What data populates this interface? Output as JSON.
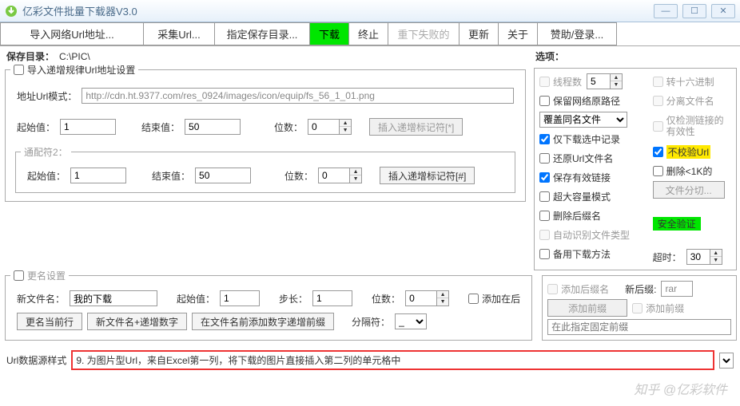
{
  "window": {
    "title": "亿彩文件批量下载器V3.0"
  },
  "toolbar": {
    "import_url": "导入网络Url地址...",
    "collect_url": "采集Url...",
    "set_dir": "指定保存目录...",
    "download": "下载",
    "stop": "终止",
    "redownload": "重下失败的",
    "update": "更新",
    "about": "关于",
    "sponsor": "赞助/登录..."
  },
  "save_dir": {
    "label": "保存目录：",
    "value": "C:\\PIC\\"
  },
  "url_pattern": {
    "legend": "导入递增规律Url地址设置",
    "pattern_label": "地址Url模式：",
    "pattern_value": "http://cdn.ht.9377.com/res_0924/images/icon/equip/fs_56_1_01.png",
    "start_label": "起始值：",
    "start_value": "1",
    "end_label": "结束值：",
    "end_value": "50",
    "digits_label": "位数：",
    "digits_value": "0",
    "insert1": "插入递增标记符[*]",
    "wildcard_label": "通配符2：",
    "insert2": "插入递增标记符[#]"
  },
  "options": {
    "title": "选项：",
    "threads_label": "线程数",
    "threads_value": "5",
    "to_hex": "转十六进制",
    "keep_path": "保留网络原路径",
    "split_name": "分离文件名",
    "overwrite": "覆盖同名文件",
    "check_only": "仅检测链接的有效性",
    "download_checked": "仅下载选中记录",
    "no_verify_url": "不校验Url",
    "restore_name": "还原Url文件名",
    "delete_lt1k": "删除<1K的",
    "keep_valid": "保存有效链接",
    "file_split": "文件分切...",
    "big_capacity": "超大容量模式",
    "delete_ext": "删除后缀名",
    "security": "安全验证",
    "auto_detect": "自动识别文件类型",
    "backup_method": "备用下载方法",
    "timeout_label": "超时：",
    "timeout_value": "30"
  },
  "rename": {
    "legend": "更名设置",
    "newname_label": "新文件名：",
    "newname_value": "我的下载",
    "start_label": "起始值：",
    "start_value": "1",
    "step_label": "步长：",
    "step_value": "1",
    "digits_label": "位数：",
    "digits_value": "0",
    "append_after": "添加在后",
    "rename_current": "更名当前行",
    "newname_inc": "新文件名+递增数字",
    "add_prefix_num": "在文件名前添加数字递增前缀",
    "sep_label": "分隔符：",
    "sep_value": "_"
  },
  "suffix": {
    "add_ext": "添加后缀名",
    "new_ext_label": "新后缀:",
    "new_ext_value": "rar",
    "add_prefix_btn": "添加前缀",
    "add_prefix_cb": "添加前缀",
    "fixed_prefix_ph": "在此指定固定前缀"
  },
  "datasource": {
    "label": "Url数据源样式",
    "value": "9. 为图片型Url，来自Excel第一列，将下载的图片直接插入第二列的单元格中"
  },
  "watermark": "知乎 @亿彩软件"
}
